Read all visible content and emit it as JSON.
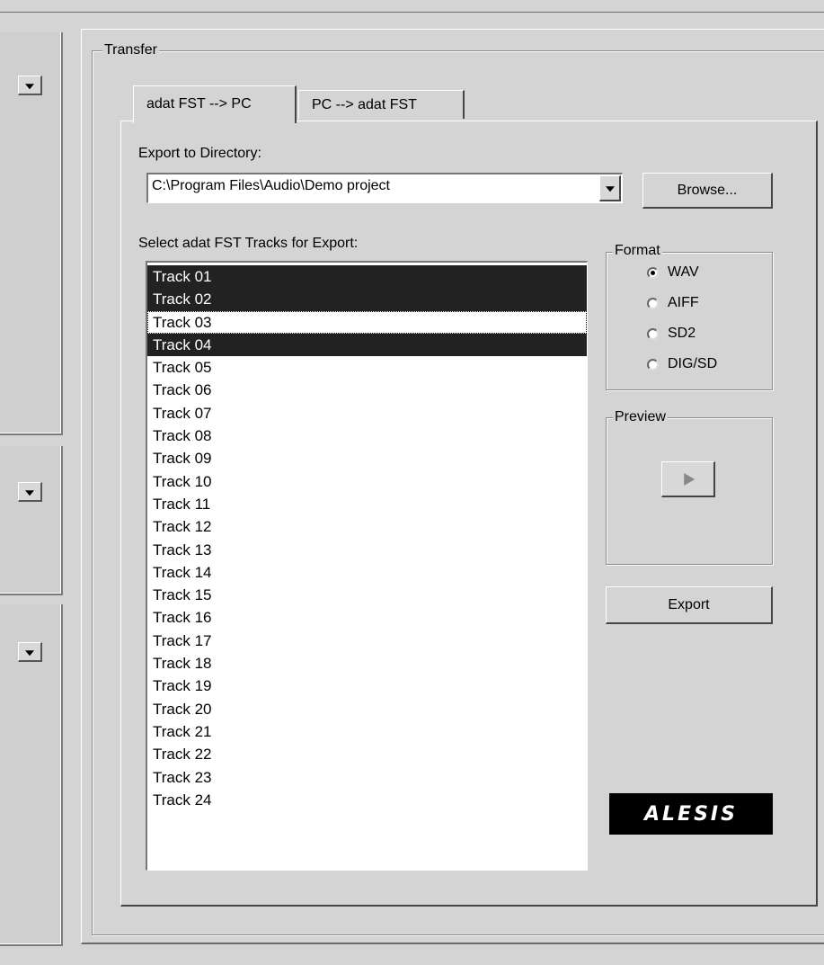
{
  "transfer": {
    "legend": "Transfer",
    "tabs": [
      {
        "label": "adat FST --> PC",
        "active": true
      },
      {
        "label": "PC --> adat FST",
        "active": false
      }
    ],
    "export_dir_label": "Export to Directory:",
    "directory_value": "C:\\Program Files\\Audio\\Demo project",
    "browse_label": "Browse...",
    "tracks_label": "Select adat FST Tracks for Export:",
    "tracks": [
      {
        "label": "Track 01",
        "selected": true
      },
      {
        "label": "Track 02",
        "selected": true
      },
      {
        "label": "Track 03",
        "selected": false,
        "focused": true
      },
      {
        "label": "Track 04",
        "selected": true
      },
      {
        "label": "Track 05",
        "selected": false
      },
      {
        "label": "Track 06",
        "selected": false
      },
      {
        "label": "Track 07",
        "selected": false
      },
      {
        "label": "Track 08",
        "selected": false
      },
      {
        "label": "Track 09",
        "selected": false
      },
      {
        "label": "Track 10",
        "selected": false
      },
      {
        "label": "Track 11",
        "selected": false
      },
      {
        "label": "Track 12",
        "selected": false
      },
      {
        "label": "Track 13",
        "selected": false
      },
      {
        "label": "Track 14",
        "selected": false
      },
      {
        "label": "Track 15",
        "selected": false
      },
      {
        "label": "Track 16",
        "selected": false
      },
      {
        "label": "Track 17",
        "selected": false
      },
      {
        "label": "Track 18",
        "selected": false
      },
      {
        "label": "Track 19",
        "selected": false
      },
      {
        "label": "Track 20",
        "selected": false
      },
      {
        "label": "Track 21",
        "selected": false
      },
      {
        "label": "Track 22",
        "selected": false
      },
      {
        "label": "Track 23",
        "selected": false
      },
      {
        "label": "Track 24",
        "selected": false
      }
    ],
    "format": {
      "legend": "Format",
      "options": [
        {
          "label": "WAV",
          "checked": true
        },
        {
          "label": "AIFF",
          "checked": false
        },
        {
          "label": "SD2",
          "checked": false
        },
        {
          "label": "DIG/SD",
          "checked": false
        }
      ]
    },
    "preview": {
      "legend": "Preview",
      "play_icon": "play-icon"
    },
    "export_label": "Export",
    "logo_text": "ALESIS"
  },
  "colors": {
    "window_bg": "#d4d4d4",
    "selection_bg": "#222222",
    "list_bg": "#ffffff",
    "logo_bg": "#000000"
  }
}
